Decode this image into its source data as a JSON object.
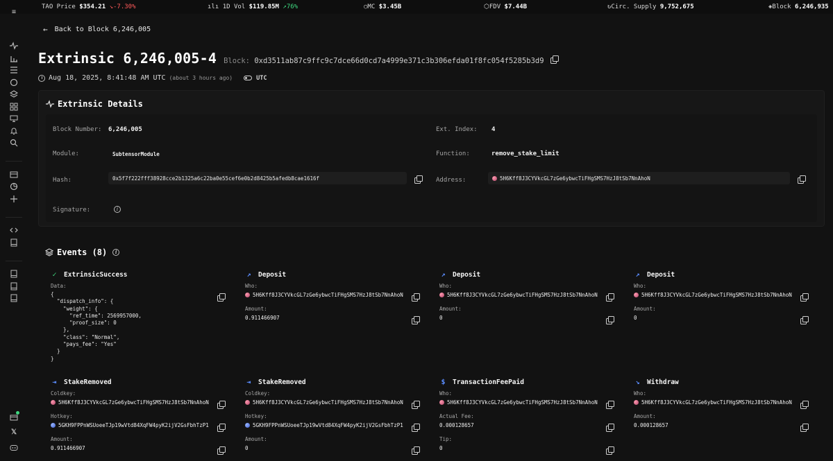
{
  "ticker": {
    "tao_price_label": "TAO Price",
    "tao_price_value": "$354.21",
    "tao_price_change": "↘-7.30%",
    "vol_label": "1D Vol",
    "vol_value": "$119.85M",
    "vol_change": "↗76%",
    "mc_label": "MC",
    "mc_value": "$3.45B",
    "fdv_label": "FDV",
    "fdv_value": "$7.44B",
    "supply_label": "Circ. Supply",
    "supply_value": "9,752,675",
    "block_label": "Block",
    "block_value": "6,246,935"
  },
  "nav": {
    "back_label": "Back to Block 6,246,005"
  },
  "header": {
    "title": "Extrinsic 6,246,005-4",
    "block_label": "Block:",
    "block_hash": "0xd3511ab87c9ffc9c7dce66d0cd7a4999e371c3b306efda01f8fc054f5285b3d9",
    "timestamp": "Aug 18, 2025, 8:41:48 AM UTC",
    "relative_time": "(about 3 hours ago)",
    "tz_toggle_label": "UTC"
  },
  "details": {
    "title": "Extrinsic Details",
    "block_number_label": "Block Number:",
    "block_number": "6,246,005",
    "ext_index_label": "Ext. Index:",
    "ext_index": "4",
    "module_label": "Module:",
    "module": "SubtensorModule",
    "function_label": "Function:",
    "function": "remove_stake_limit",
    "hash_label": "Hash:",
    "hash": "0x5f7f222fff38928cce2b1325a6c22ba0e55cef6e0b2d8425b5afedb8cae1616f",
    "address_label": "Address:",
    "address": "5H6Kff8J3CYVkcGL7zGe6ybwcTiFHgSMS7HzJ8tSb7NnAhoN",
    "signature_label": "Signature:"
  },
  "events": {
    "title": "Events (8)",
    "items": [
      {
        "name": "ExtrinsicSuccess",
        "data_label": "Data:",
        "data_json": "{\n  \"dispatch_info\": {\n    \"weight\": {\n      \"ref_time\": 2569957000,\n      \"proof_size\": 0\n    },\n    \"class\": \"Normal\",\n    \"pays_fee\": \"Yes\"\n  }\n}"
      },
      {
        "name": "Deposit",
        "who_label": "Who:",
        "who": "5H6Kff8J3CYVkcGL7zGe6ybwcTiFHgSMS7HzJ8tSb7NnAhoN",
        "amount_label": "Amount:",
        "amount": "0.911466907"
      },
      {
        "name": "Deposit",
        "who_label": "Who:",
        "who": "5H6Kff8J3CYVkcGL7zGe6ybwcTiFHgSMS7HzJ8tSb7NnAhoN",
        "amount_label": "Amount:",
        "amount": "0"
      },
      {
        "name": "Deposit",
        "who_label": "Who:",
        "who": "5H6Kff8J3CYVkcGL7zGe6ybwcTiFHgSMS7HzJ8tSb7NnAhoN",
        "amount_label": "Amount:",
        "amount": "0"
      },
      {
        "name": "StakeRemoved",
        "coldkey_label": "Coldkey:",
        "coldkey": "5H6Kff8J3CYVkcGL7zGe6ybwcTiFHgSMS7HzJ8tSb7NnAhoN",
        "hotkey_label": "Hotkey:",
        "hotkey": "5GKH9FPPnWSUoeeTJp19wVtd84XqFW4pyK2ijV2GsFbhTzP1",
        "amount_label": "Amount:",
        "amount": "0.911466907"
      },
      {
        "name": "StakeRemoved",
        "coldkey_label": "Coldkey:",
        "coldkey": "5H6Kff8J3CYVkcGL7zGe6ybwcTiFHgSMS7HzJ8tSb7NnAhoN",
        "hotkey_label": "Hotkey:",
        "hotkey": "5GKH9FPPnWSUoeeTJp19wVtd84XqFW4pyK2ijV2GsFbhTzP1",
        "amount_label": "Amount:",
        "amount": "0"
      },
      {
        "name": "TransactionFeePaid",
        "who_label": "Who:",
        "who": "5H6Kff8J3CYVkcGL7zGe6ybwcTiFHgSMS7HzJ8tSb7NnAhoN",
        "fee_label": "Actual Fee:",
        "fee": "0.000128657",
        "tip_label": "Tip:",
        "tip": "0"
      },
      {
        "name": "Withdraw",
        "who_label": "Who:",
        "who": "5H6Kff8J3CYVkcGL7zGe6ybwcTiFHgSMS7HzJ8tSb7NnAhoN",
        "amount_label": "Amount:",
        "amount": "0.000128657"
      }
    ]
  },
  "colors": {
    "background": "#121212",
    "panel": "#171717",
    "accent_blue": "#5b8dff",
    "success_green": "#3fd980",
    "negative_red": "#ff5a5a"
  }
}
